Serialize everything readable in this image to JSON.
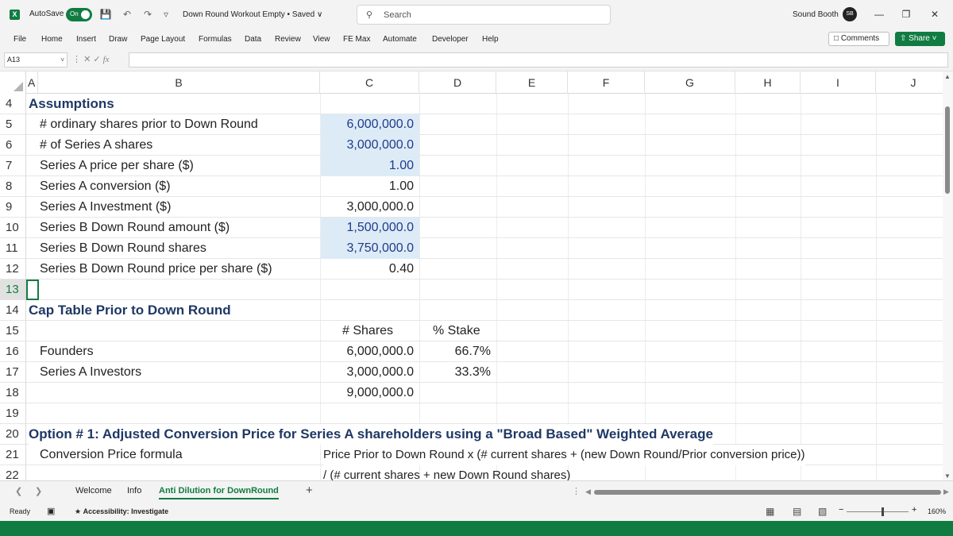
{
  "titlebar": {
    "app_icon": "X",
    "autosave_label": "AutoSave",
    "autosave_state": "On",
    "doc_title": "Down Round Workout Empty  • Saved ∨",
    "search_placeholder": "Search",
    "user_name": "Sound Booth",
    "avatar_initials": "SB",
    "icons": [
      "save-icon",
      "undo-icon",
      "redo-icon",
      "customize-icon"
    ]
  },
  "ribbon": {
    "tabs": [
      "File",
      "Home",
      "Insert",
      "Draw",
      "Page Layout",
      "Formulas",
      "Data",
      "Review",
      "View",
      "FE Max",
      "Automate",
      "Developer",
      "Help"
    ],
    "comments_label": "Comments",
    "share_label": "Share"
  },
  "formula_bar": {
    "name_box": "A13",
    "fx_label": "fx",
    "formula": ""
  },
  "columns": [
    "A",
    "B",
    "C",
    "D",
    "E",
    "F",
    "G",
    "H",
    "I",
    "J"
  ],
  "rows": [
    {
      "n": "4",
      "a": "Assumptions",
      "b": "",
      "c": "",
      "d": ""
    },
    {
      "n": "5",
      "a": "",
      "b": "# ordinary shares prior to Down Round",
      "c": "6,000,000.0",
      "d": ""
    },
    {
      "n": "6",
      "a": "",
      "b": "# of Series A shares",
      "c": "3,000,000.0",
      "d": ""
    },
    {
      "n": "7",
      "a": "",
      "b": "Series A price per share ($)",
      "c": "1.00",
      "d": ""
    },
    {
      "n": "8",
      "a": "",
      "b": "Series A conversion ($)",
      "c": "1.00",
      "d": ""
    },
    {
      "n": "9",
      "a": "",
      "b": "Series A Investment ($)",
      "c": "3,000,000.0",
      "d": ""
    },
    {
      "n": "10",
      "a": "",
      "b": "Series B Down Round amount ($)",
      "c": "1,500,000.0",
      "d": ""
    },
    {
      "n": "11",
      "a": "",
      "b": "Series B Down Round shares",
      "c": "3,750,000.0",
      "d": ""
    },
    {
      "n": "12",
      "a": "",
      "b": "Series B Down Round price per share ($)",
      "c": "0.40",
      "d": ""
    },
    {
      "n": "13",
      "a": "",
      "b": "",
      "c": "",
      "d": ""
    },
    {
      "n": "14",
      "a": "Cap Table Prior to Down Round",
      "b": "",
      "c": "",
      "d": ""
    },
    {
      "n": "15",
      "a": "",
      "b": "",
      "c": "# Shares",
      "d": "% Stake"
    },
    {
      "n": "16",
      "a": "",
      "b": "Founders",
      "c": "6,000,000.0",
      "d": "66.7%"
    },
    {
      "n": "17",
      "a": "",
      "b": "Series A Investors",
      "c": "3,000,000.0",
      "d": "33.3%"
    },
    {
      "n": "18",
      "a": "",
      "b": "",
      "c": "9,000,000.0",
      "d": ""
    },
    {
      "n": "19",
      "a": "",
      "b": "",
      "c": "",
      "d": ""
    },
    {
      "n": "20",
      "a": "Option # 1: Adjusted Conversion Price for Series A shareholders using a \"Broad Based\" Weighted Average",
      "b": "",
      "c": "",
      "d": ""
    },
    {
      "n": "21",
      "a": "",
      "b": "Conversion Price formula",
      "c": "",
      "d": "",
      "c_wide": "Price Prior to Down Round x (# current shares + (new Down Round/Prior conversion price))"
    },
    {
      "n": "22",
      "a": "",
      "b": "",
      "c": "",
      "d": "",
      "c_wide": "/ (# current shares + new Down Round shares)"
    }
  ],
  "sheets": {
    "tabs": [
      "Welcome",
      "Info",
      "Anti Dilution for DownRound"
    ],
    "active": "Anti Dilution for DownRound"
  },
  "statusbar": {
    "ready": "Ready",
    "accessibility": "Accessibility: Investigate",
    "zoom": "160%"
  },
  "colors": {
    "excel_green": "#107c41",
    "section_title": "#1f3864",
    "input_fill": "#ddebf7",
    "input_text": "#1f3b8a"
  }
}
